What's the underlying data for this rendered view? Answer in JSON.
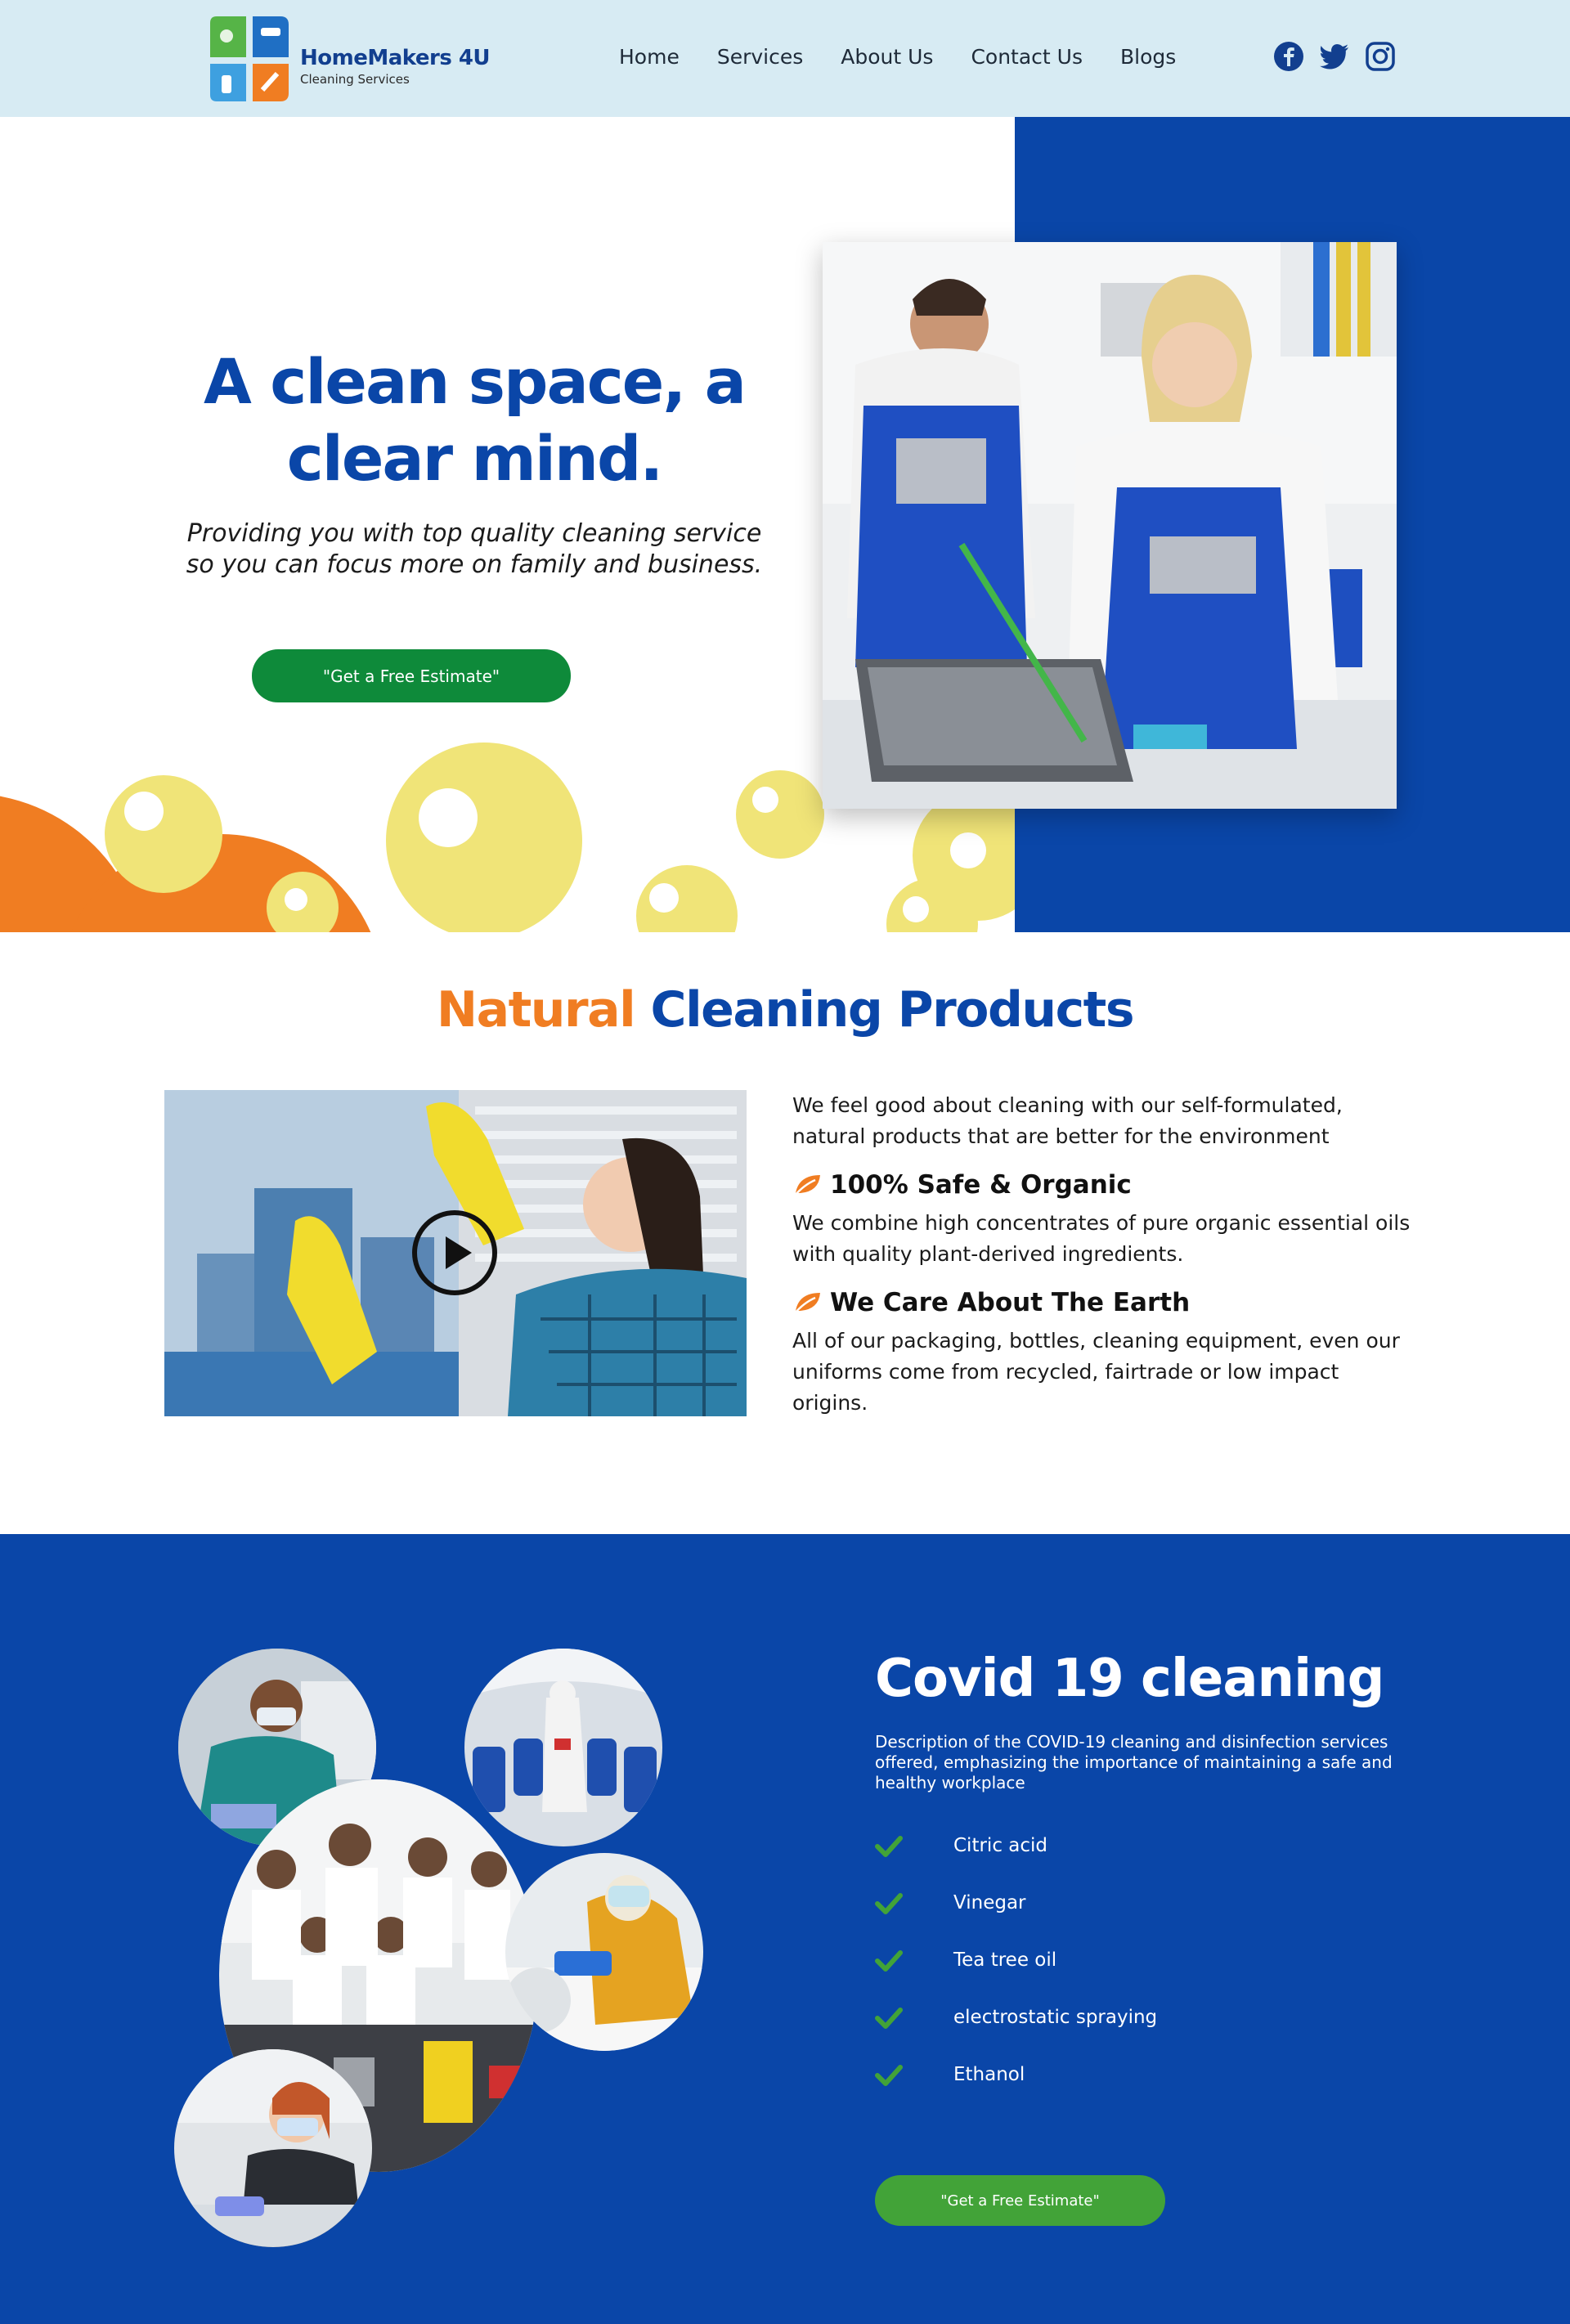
{
  "header": {
    "logo_name": "HomeMakers 4U",
    "logo_sub": "Cleaning Services",
    "nav": [
      "Home",
      "Services",
      "About Us",
      "Contact Us",
      "Blogs"
    ],
    "social": [
      "facebook-icon",
      "twitter-icon",
      "instagram-icon"
    ]
  },
  "hero": {
    "title_line1": "A clean space, a",
    "title_line2": "clear mind.",
    "subtitle_line1": "Providing you with top quality cleaning service",
    "subtitle_line2": "so you can focus more on family and business.",
    "cta": "\"Get a Free Estimate\""
  },
  "natural": {
    "title_orange": "Natural",
    "title_blue": "Cleaning Products",
    "intro": "We feel good about cleaning with our self-formulated, natural products that are better for the environment",
    "features": [
      {
        "title": "100% Safe & Organic",
        "text": "We combine high concentrates of pure organic essential oils with quality plant-derived ingredients."
      },
      {
        "title": "We Care About The Earth",
        "text": "All of our packaging, bottles, cleaning equipment, even our uniforms come from recycled, fairtrade or low impact origins."
      }
    ]
  },
  "covid": {
    "title": "Covid 19 cleaning",
    "description": "Description of the COVID-19 cleaning and disinfection services offered, emphasizing the importance of maintaining a safe and healthy workplace",
    "items": [
      "Citric acid",
      "Vinegar",
      "Tea tree oil",
      "electrostatic spraying",
      "Ethanol"
    ],
    "cta": "\"Get a Free Estimate\""
  },
  "colors": {
    "brand_blue": "#0a46a8",
    "accent_orange": "#f07d22",
    "cta_green": "#0e8a3a",
    "header_bg": "#d7ebf3"
  }
}
